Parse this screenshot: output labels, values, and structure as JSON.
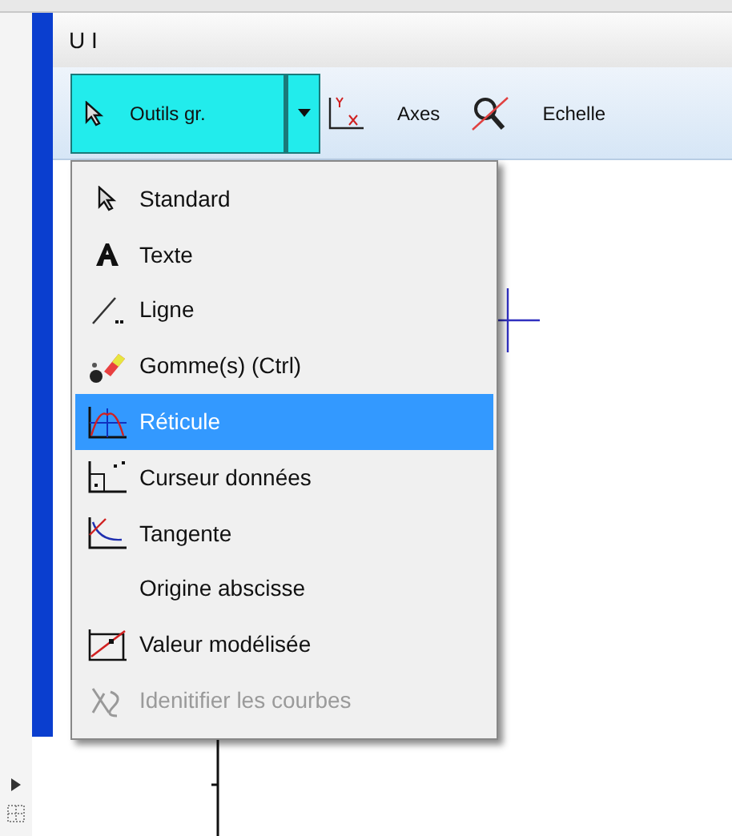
{
  "window": {
    "title": "U I"
  },
  "toolbar": {
    "tools_button": {
      "label": "Outils gr.",
      "expanded": true
    },
    "buttons": [
      {
        "label": "Axes"
      },
      {
        "label": "Echelle"
      }
    ]
  },
  "menu": {
    "items": [
      {
        "label": "Standard",
        "selected": false,
        "disabled": false
      },
      {
        "label": "Texte",
        "selected": false,
        "disabled": false
      },
      {
        "label": "Ligne",
        "selected": false,
        "disabled": false
      },
      {
        "label": "Gomme(s) (Ctrl)",
        "selected": false,
        "disabled": false
      },
      {
        "label": "Réticule",
        "selected": true,
        "disabled": false
      },
      {
        "label": "Curseur données",
        "selected": false,
        "disabled": false
      },
      {
        "label": "Tangente",
        "selected": false,
        "disabled": false
      },
      {
        "label": "Origine abscisse",
        "selected": false,
        "disabled": false
      },
      {
        "label": "Valeur modélisée",
        "selected": false,
        "disabled": false
      },
      {
        "label": "Idenitifier les courbes",
        "selected": false,
        "disabled": true
      }
    ]
  }
}
